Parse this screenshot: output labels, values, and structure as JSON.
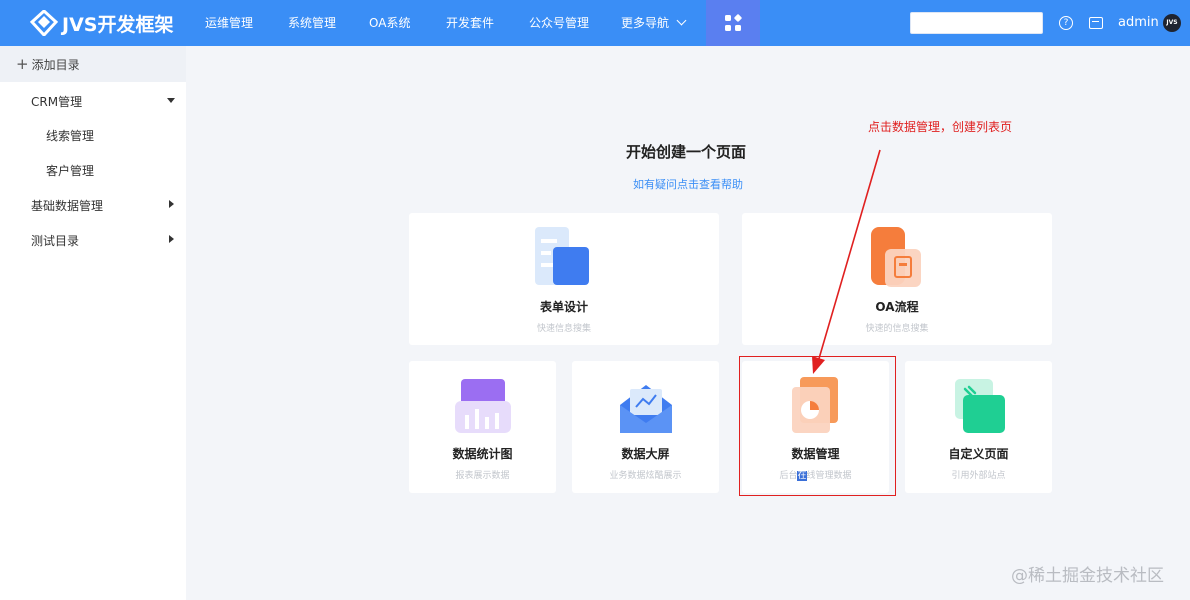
{
  "header": {
    "logo_text": "JVS开发框架",
    "nav": [
      "运维管理",
      "系统管理",
      "OA系统",
      "开发套件",
      "公众号管理",
      "更多导航"
    ],
    "search_value": "",
    "user": "admin",
    "avatar_text": "JVS"
  },
  "sidebar": {
    "add_label": "添加目录",
    "items": [
      {
        "label": "CRM管理",
        "expanded": true
      },
      {
        "label": "线索管理"
      },
      {
        "label": "客户管理"
      },
      {
        "label": "基础数据管理",
        "expanded": false
      },
      {
        "label": "测试目录",
        "expanded": false
      }
    ]
  },
  "main": {
    "title": "开始创建一个页面",
    "help_link": "如有疑问点击查看帮助",
    "cards": [
      {
        "title": "表单设计",
        "subtitle": "快速信息搜集"
      },
      {
        "title": "OA流程",
        "subtitle": "快速的信息搜集"
      },
      {
        "title": "数据统计图",
        "subtitle": "报表展示数据"
      },
      {
        "title": "数据大屏",
        "subtitle": "业务数据炫酷展示"
      },
      {
        "title": "数据管理",
        "subtitle_pre": "后台",
        "subtitle_sel": "在",
        "subtitle_post": "线管理数据"
      },
      {
        "title": "自定义页面",
        "subtitle": "引用外部站点"
      }
    ]
  },
  "annotation": {
    "text": "点击数据管理，创建列表页",
    "color": "#e02020"
  },
  "watermark": "@稀土掘金技术社区",
  "colors": {
    "primary": "#3a8ef6",
    "apps_button": "#5a7ff0",
    "highlight": "#e02020"
  }
}
